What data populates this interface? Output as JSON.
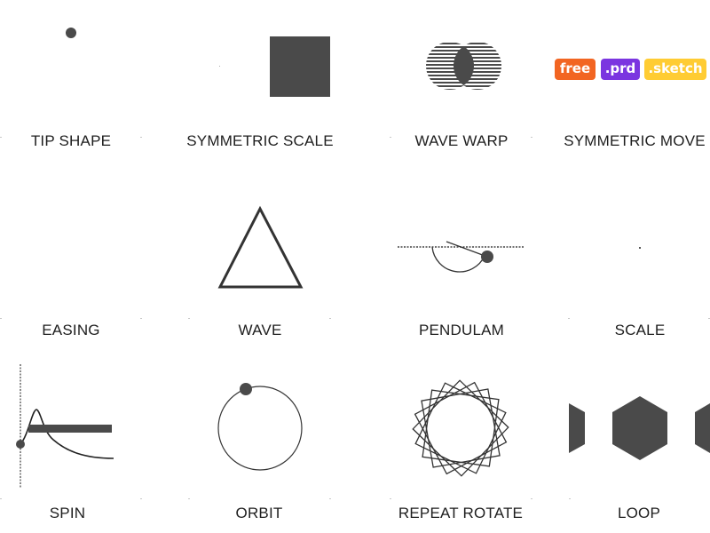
{
  "cards": [
    {
      "label": "TIP SHAPE"
    },
    {
      "label": "SYMMETRIC SCALE"
    },
    {
      "label": "WAVE WARP"
    },
    {
      "label": "SYMMETRIC MOVE"
    },
    {
      "label": "EASING"
    },
    {
      "label": "WAVE"
    },
    {
      "label": "PENDULAM"
    },
    {
      "label": "SCALE"
    },
    {
      "label": "SPIN"
    },
    {
      "label": "ORBIT"
    },
    {
      "label": "REPEAT ROTATE"
    },
    {
      "label": "LOOP"
    }
  ],
  "badges": [
    {
      "label": "free",
      "color": "#f26522"
    },
    {
      "label": ".prd",
      "color": "#7b35e0"
    },
    {
      "label": ".sketch",
      "color": "#ffcc33"
    }
  ],
  "colors": {
    "shape_fill": "#4a4a4a",
    "stroke": "#333333",
    "text": "#1e1e1e"
  }
}
